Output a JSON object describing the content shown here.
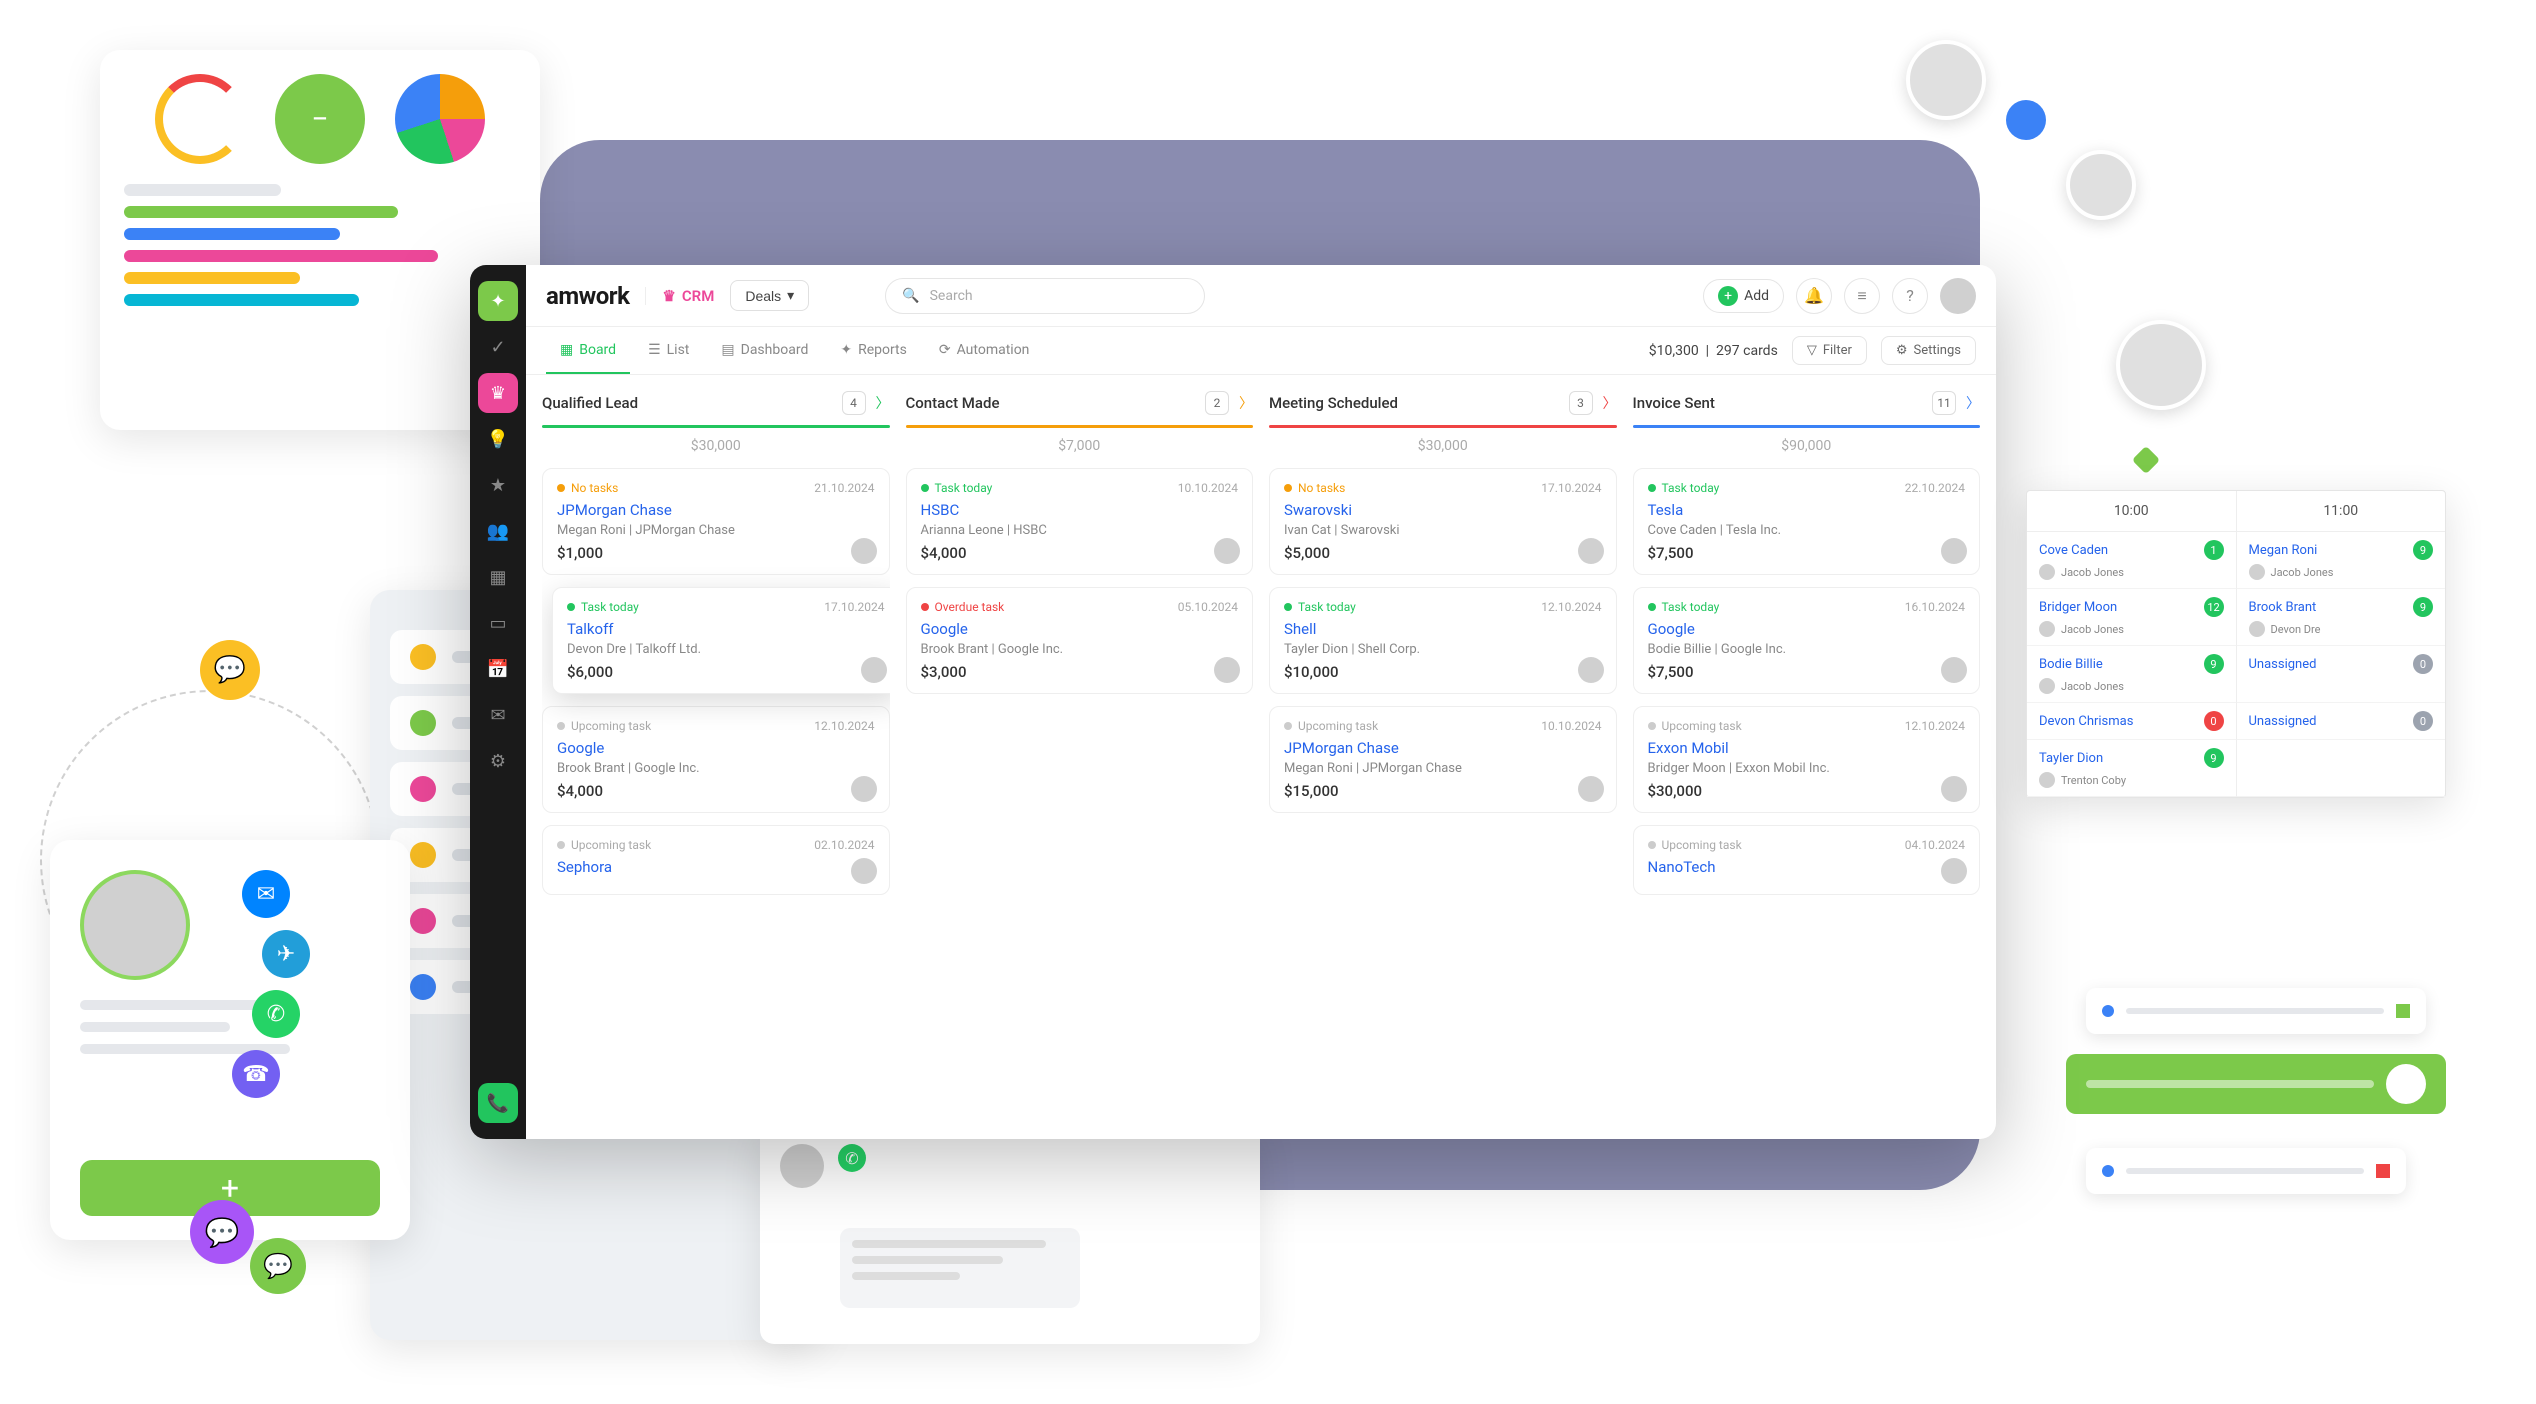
{
  "app": {
    "logo": "amwork",
    "module": "CRM",
    "dropdown": "Deals",
    "search_placeholder": "Search",
    "add_label": "Add",
    "help_label": "?",
    "summary_amount": "$10,300",
    "summary_count": "297 cards",
    "filter_label": "Filter",
    "settings_label": "Settings"
  },
  "tabs": {
    "board": "Board",
    "list": "List",
    "dashboard": "Dashboard",
    "reports": "Reports",
    "automation": "Automation"
  },
  "columns": [
    {
      "title": "Qualified Lead",
      "count": "4",
      "total": "$30,000",
      "color": "#22c55e",
      "chev": "#22c55e",
      "cards": [
        {
          "status": "No tasks",
          "status_cls": "amber",
          "date": "21.10.2024",
          "name": "JPMorgan Chase",
          "sub": "Megan Roni  |  JPMorgan Chase",
          "amount": "$1,000"
        },
        {
          "status": "Task today",
          "status_cls": "green",
          "date": "17.10.2024",
          "name": "Talkoff",
          "sub": "Devon Dre  |  Talkoff Ltd.",
          "amount": "$6,000",
          "lifted": true
        },
        {
          "status": "Upcoming task",
          "status_cls": "gray",
          "date": "12.10.2024",
          "name": "Google",
          "sub": "Brook Brant  |  Google Inc.",
          "amount": "$4,000"
        },
        {
          "status": "Upcoming task",
          "status_cls": "gray",
          "date": "02.10.2024",
          "name": "Sephora",
          "sub": "",
          "amount": ""
        }
      ]
    },
    {
      "title": "Contact Made",
      "count": "2",
      "total": "$7,000",
      "color": "#f59e0b",
      "chev": "#f59e0b",
      "cards": [
        {
          "status": "Task today",
          "status_cls": "green",
          "date": "10.10.2024",
          "name": "HSBC",
          "sub": "Arianna Leone  |  HSBC",
          "amount": "$4,000"
        },
        {
          "status": "Overdue task",
          "status_cls": "red",
          "date": "05.10.2024",
          "name": "Google",
          "sub": "Brook Brant  |  Google Inc.",
          "amount": "$3,000"
        }
      ]
    },
    {
      "title": "Meeting Scheduled",
      "count": "3",
      "total": "$30,000",
      "color": "#ef4444",
      "chev": "#ef4444",
      "cards": [
        {
          "status": "No tasks",
          "status_cls": "amber",
          "date": "17.10.2024",
          "name": "Swarovski",
          "sub": "Ivan Cat  |  Swarovski",
          "amount": "$5,000"
        },
        {
          "status": "Task today",
          "status_cls": "green",
          "date": "12.10.2024",
          "name": "Shell",
          "sub": "Tayler Dion  |  Shell Corp.",
          "amount": "$10,000"
        },
        {
          "status": "Upcoming task",
          "status_cls": "gray",
          "date": "10.10.2024",
          "name": "JPMorgan Chase",
          "sub": "Megan Roni  |  JPMorgan Chase",
          "amount": "$15,000"
        }
      ]
    },
    {
      "title": "Invoice Sent",
      "count": "11",
      "total": "$90,000",
      "color": "#3b82f6",
      "chev": "#3b82f6",
      "cards": [
        {
          "status": "Task today",
          "status_cls": "green",
          "date": "22.10.2024",
          "name": "Tesla",
          "sub": "Cove Caden  |  Tesla Inc.",
          "amount": "$7,500"
        },
        {
          "status": "Task today",
          "status_cls": "green",
          "date": "16.10.2024",
          "name": "Google",
          "sub": "Bodie Billie  |  Google Inc.",
          "amount": "$7,500"
        },
        {
          "status": "Upcoming task",
          "status_cls": "gray",
          "date": "12.10.2024",
          "name": "Exxon Mobil",
          "sub": "Bridger Moon  |  Exxon Mobil Inc.",
          "amount": "$30,000"
        },
        {
          "status": "Upcoming task",
          "status_cls": "gray",
          "date": "04.10.2024",
          "name": "NanoTech",
          "sub": "",
          "amount": ""
        }
      ]
    }
  ],
  "schedule": {
    "h1": "10:00",
    "h2": "11:00",
    "rows": [
      {
        "l": {
          "name": "Cove Caden",
          "badge": "1",
          "bc": "#22c55e",
          "ass": "Jacob Jones"
        },
        "r": {
          "name": "Megan Roni",
          "badge": "9",
          "bc": "#22c55e",
          "ass": "Jacob Jones"
        }
      },
      {
        "l": {
          "name": "Bridger Moon",
          "badge": "12",
          "bc": "#22c55e",
          "ass": "Jacob Jones"
        },
        "r": {
          "name": "Brook Brant",
          "badge": "9",
          "bc": "#22c55e",
          "ass": "Devon Dre"
        }
      },
      {
        "l": {
          "name": "Bodie Billie",
          "badge": "9",
          "bc": "#22c55e",
          "ass": "Jacob Jones"
        },
        "r": {
          "name": "Unassigned",
          "badge": "0",
          "bc": "#9ca3af",
          "ass": ""
        }
      },
      {
        "l": {
          "name": "Devon Chrismas",
          "badge": "0",
          "bc": "#ef4444",
          "ass": ""
        },
        "r": {
          "name": "Unassigned",
          "badge": "0",
          "bc": "#9ca3af",
          "ass": ""
        }
      },
      {
        "l": {
          "name": "Tayler Dion",
          "badge": "9",
          "bc": "#22c55e",
          "ass": "Trenton Coby"
        },
        "r": {
          "name": "",
          "badge": "",
          "bc": "",
          "ass": ""
        }
      }
    ]
  }
}
